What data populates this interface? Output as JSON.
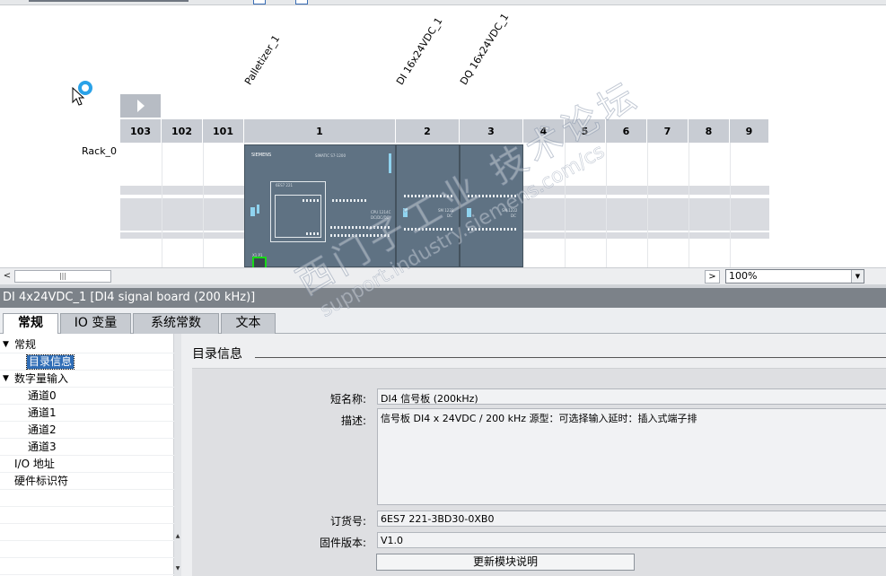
{
  "device_view": {
    "module_names": [
      "Palletizer_1",
      "DI 16x24VDC_1",
      "DQ 16x24VDC_1"
    ],
    "rack_label": "Rack_0",
    "slots": [
      "103",
      "102",
      "101",
      "1",
      "2",
      "3",
      "4",
      "5",
      "6",
      "7",
      "8",
      "9"
    ],
    "cpu": {
      "brand": "SIEMENS",
      "model_line": "SIMATIC S7-1200",
      "cpu_type": "CPU 1214C",
      "cpu_variant": "DC/DC/DC",
      "sm1": "SM 1221",
      "sm1_sub": "DC",
      "sm2": "SM 1222",
      "sm2_sub": "DC"
    }
  },
  "view_controls": {
    "zoom_value": "100%",
    "scroll_left_glyph": "<",
    "scroll_right_glyph": ">",
    "scroll_thumb_grip": "|||",
    "dropdown_glyph": "▼"
  },
  "properties": {
    "title": "DI 4x24VDC_1 [DI4 signal board (200 kHz)]",
    "tabs": [
      {
        "label": "常规",
        "active": true
      },
      {
        "label": "IO 变量",
        "active": false
      },
      {
        "label": "系统常数",
        "active": false
      },
      {
        "label": "文本",
        "active": false
      }
    ],
    "tree": [
      {
        "label": "常规",
        "toggle": "▼",
        "level": 0
      },
      {
        "label": "目录信息",
        "toggle": "",
        "level": 1,
        "selected": true
      },
      {
        "label": "数字量输入",
        "toggle": "▼",
        "level": 0
      },
      {
        "label": "通道0",
        "toggle": "",
        "level": 1
      },
      {
        "label": "通道1",
        "toggle": "",
        "level": 1
      },
      {
        "label": "通道2",
        "toggle": "",
        "level": 1
      },
      {
        "label": "通道3",
        "toggle": "",
        "level": 1
      },
      {
        "label": "I/O 地址",
        "toggle": "",
        "level": 0
      },
      {
        "label": "硬件标识符",
        "toggle": "",
        "level": 0
      }
    ],
    "section_title": "目录信息",
    "fields": {
      "short_name_label": "短名称:",
      "short_name_value": "DI4 信号板 (200kHz)",
      "description_label": "描述:",
      "description_value": "信号板 DI4 x 24VDC / 200 kHz 源型：可选择输入延时：插入式端子排",
      "order_no_label": "订货号:",
      "order_no_value": "6ES7 221-3BD30-0XB0",
      "firmware_label": "固件版本:",
      "firmware_value": "V1.0",
      "update_button": "更新模块说明"
    }
  },
  "watermark": {
    "line1": "西门子工业 技术论坛",
    "line2": "support.industry.siemens.com/cs"
  }
}
